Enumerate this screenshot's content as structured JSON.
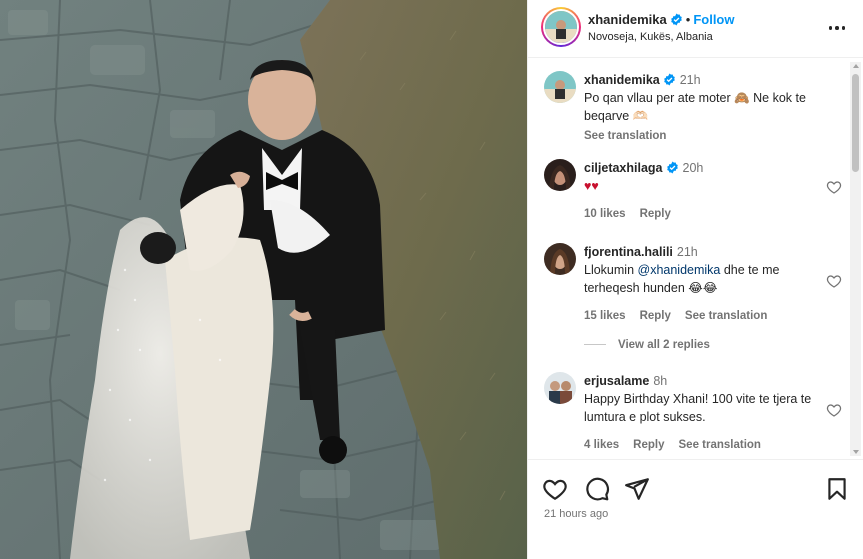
{
  "post": {
    "username": "xhanidemika",
    "follow_label": "Follow",
    "separator": "•",
    "location": "Novoseja, Kukës, Albania",
    "time_ago": "21 hours ago"
  },
  "caption": {
    "username": "xhanidemika",
    "time": "21h",
    "text": "Po qan vllau per ate moter 🙈 Ne kok te beqarve 🫶🏻",
    "see_translation": "See translation"
  },
  "comments": [
    {
      "username": "ciljetaxhilaga",
      "time": "20h",
      "text": "♥♥",
      "likes": "10 likes",
      "reply": "Reply",
      "see_translation": ""
    },
    {
      "username": "fjorentina.halili",
      "time": "21h",
      "text_before": "Llokumin ",
      "mention": "@xhanidemika",
      "text_after": " dhe te me terheqesh hunden 😂😂",
      "likes": "15 likes",
      "reply": "Reply",
      "see_translation": "See translation",
      "view_replies": "View all 2 replies"
    },
    {
      "username": "erjusalame",
      "time": "8h",
      "text": "Happy Birthday Xhani! 100 vite te tjera te lumtura e plot sukses.",
      "likes": "4 likes",
      "reply": "Reply",
      "see_translation": "See translation"
    }
  ],
  "icons": {
    "like": "heart-icon",
    "comment": "comment-icon",
    "share": "share-icon",
    "save": "bookmark-icon",
    "more": "more-horizontal-icon",
    "verified": "verified-badge-icon"
  },
  "colors": {
    "accent": "#0095f6",
    "verified": "#0095f6",
    "muted": "#737373",
    "text": "#262626",
    "mention": "#00376b",
    "heart_red": "#c8102e"
  }
}
